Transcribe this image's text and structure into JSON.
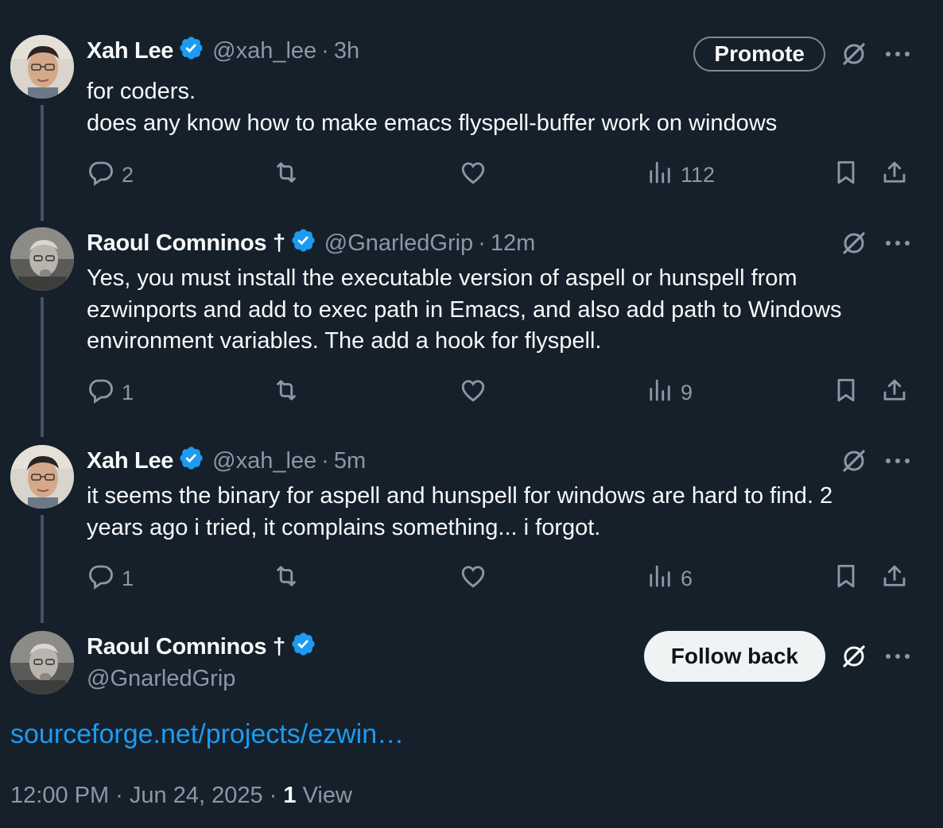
{
  "tweets": [
    {
      "name": "Xah Lee",
      "handle": "@xah_lee",
      "time": "3h",
      "lines": [
        "for coders.",
        "does any know how to make emacs flyspell-buffer work on windows"
      ],
      "replies": "2",
      "reposts": "",
      "likes": "",
      "views": "112",
      "promote_label": "Promote"
    },
    {
      "name": "Raoul Comninos †",
      "handle": "@GnarledGrip",
      "time": "12m",
      "lines": [
        "Yes, you must install the executable version of aspell or hunspell from",
        "ezwinports and add to exec path in Emacs, and also add path to Windows",
        "environment variables. The add a hook for flyspell."
      ],
      "replies": "1",
      "reposts": "",
      "likes": "",
      "views": "9"
    },
    {
      "name": "Xah Lee",
      "handle": "@xah_lee",
      "time": "5m",
      "lines": [
        "it seems the binary for aspell and hunspell for windows are hard to find. 2",
        "years ago i tried, it complains something... i forgot."
      ],
      "replies": "1",
      "reposts": "",
      "likes": "",
      "views": "6"
    }
  ],
  "focused": {
    "name": "Raoul Comninos †",
    "handle": "@GnarledGrip",
    "follow_label": "Follow back",
    "link_text": "sourceforge.net/projects/ezwin…",
    "timestamp": "12:00 PM · Jun 24, 2025 · ",
    "views_count": "1",
    "views_label": " View"
  },
  "icons": {
    "reply": "reply-icon",
    "repost": "repost-icon",
    "like": "heart-icon",
    "views": "analytics-icon",
    "bookmark": "bookmark-icon",
    "share": "share-icon",
    "grok": "grok-icon",
    "more": "more-icon",
    "verified": "verified-badge-icon"
  },
  "colors": {
    "background": "#15202b",
    "link": "#1d9bf0",
    "verified": "#1d9bf0",
    "secondary_text": "#8b98a5"
  }
}
